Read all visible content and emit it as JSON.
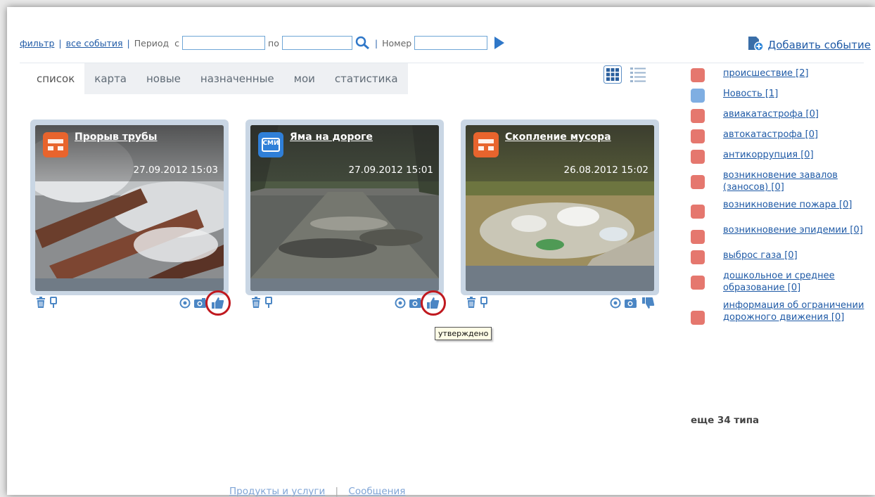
{
  "filter": {
    "filter_link": "фильтр",
    "all_events_link": "все события",
    "period_label": "Период",
    "from_label": "с",
    "from_value": "",
    "to_label": "по",
    "to_value": "",
    "number_label": "Номер",
    "number_value": ""
  },
  "add_event": "Добавить событие",
  "tabs": [
    "список",
    "карта",
    "новые",
    "назначенные",
    "мои",
    "статистика"
  ],
  "active_tab": "список",
  "cards": [
    {
      "title": "Прорыв трубы",
      "date": "27.09.2012 15:03",
      "category": "происшествие",
      "approved": true
    },
    {
      "title": "Яма на дороге",
      "date": "27.09.2012 15:01",
      "category": "СМИ",
      "approved": true
    },
    {
      "title": "Скопление мусора",
      "date": "26.08.2012 15:02",
      "category": "происшествие",
      "approved": false
    }
  ],
  "smi_badge": "СМИ",
  "tooltip": "утверждено",
  "categories": [
    {
      "label": "происшествие [2]",
      "icon": "incident-icon"
    },
    {
      "label": "Новость [1]",
      "icon": "news-icon"
    },
    {
      "label": "авиакатастрофа [0]",
      "icon": "plane-crash-icon"
    },
    {
      "label": "автокатастрофа [0]",
      "icon": "car-crash-icon"
    },
    {
      "label": "антикоррупция [0]",
      "icon": "anticorruption-icon"
    },
    {
      "label": "возникновение завалов (заносов) [0]",
      "icon": "blockage-icon"
    },
    {
      "label": "возникновение пожара [0]",
      "icon": "fire-icon"
    },
    {
      "label": "возникновение эпидемии [0]",
      "icon": "biohazard-icon"
    },
    {
      "label": "выброс газа [0]",
      "icon": "gas-icon"
    },
    {
      "label": "дошкольное и среднее образование [0]",
      "icon": "education-icon"
    },
    {
      "label": "информация об ограничении дорожного движения [0]",
      "icon": "traffic-restriction-icon"
    }
  ],
  "more_types": "еще 34 типа",
  "footer": {
    "products": "Продукты и услуги",
    "messages": "Сообщения"
  },
  "colors": {
    "accent": "#1f5aa6",
    "incident": "#e8642d",
    "smi": "#2f7fd8",
    "category_icon": "#e5776e",
    "highlight": "#c0191f"
  }
}
